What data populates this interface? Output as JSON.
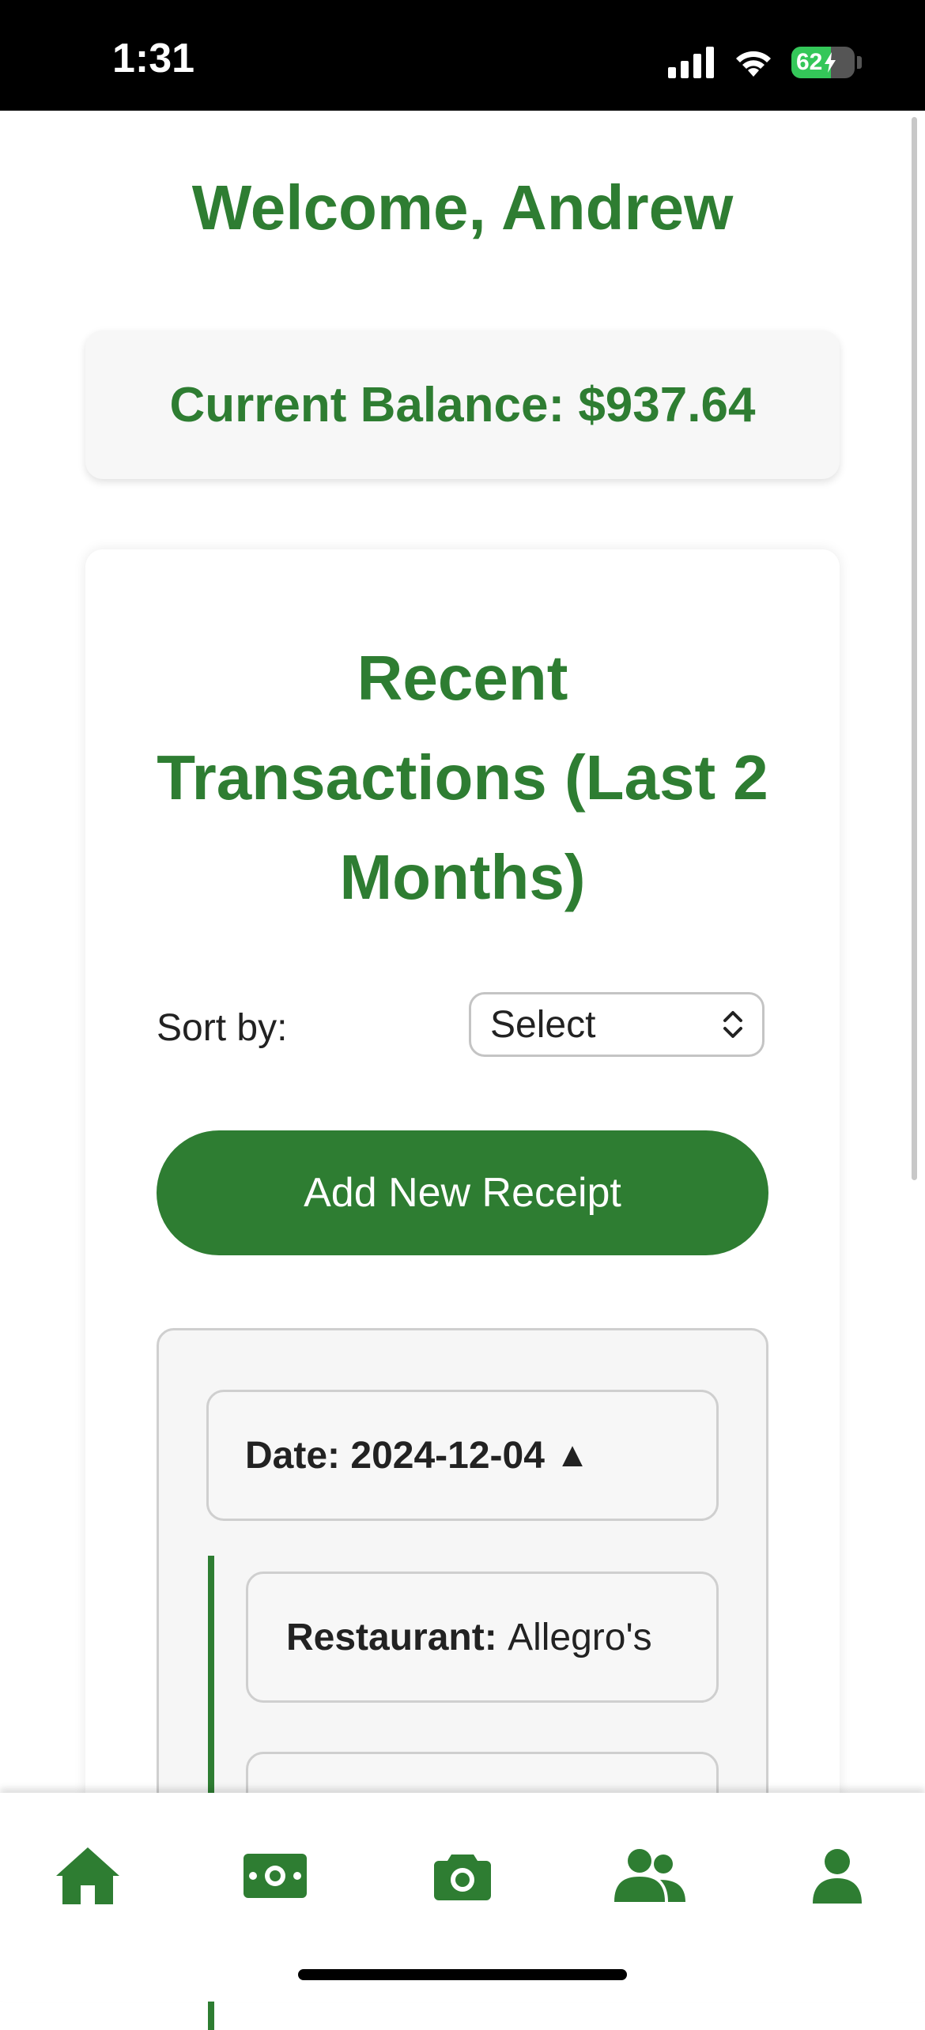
{
  "status_bar": {
    "time": "1:31",
    "battery_percent": "62",
    "battery_level": 0.62
  },
  "header": {
    "welcome": "Welcome, Andrew"
  },
  "balance": {
    "text": "Current Balance: $937.64"
  },
  "transactions": {
    "title": "Recent Transactions (Last 2 Months)",
    "sort_label": "Sort by:",
    "sort_value": "Select",
    "add_button": "Add New Receipt",
    "date_label": "Date:",
    "date_value": "2024-12-04",
    "date_toggle": "▲",
    "items": [
      {
        "label": "Restaurant:",
        "value": "Allegro's"
      }
    ]
  },
  "tabs": [
    "home-icon",
    "money-icon",
    "camera-icon",
    "users-icon",
    "profile-icon"
  ],
  "colors": {
    "brand": "#2e7d32",
    "battery": "#34c759"
  }
}
